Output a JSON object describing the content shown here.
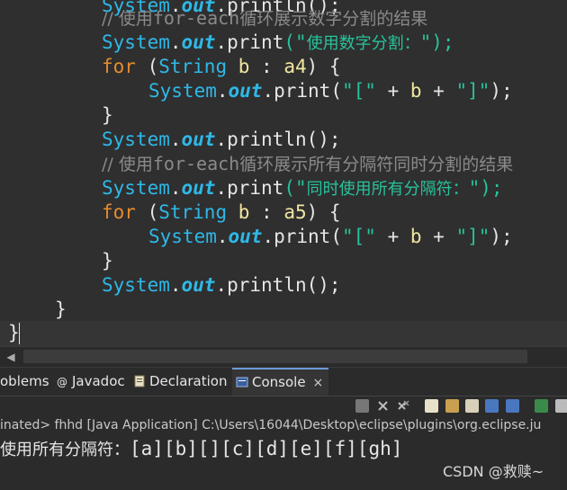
{
  "editor": {
    "line0": {
      "a": "System",
      "b": "out",
      "c": "println",
      "d": "();"
    },
    "line1": {
      "slash": "// ",
      "cn1": "使用",
      "kw": "for-each",
      "cn2": "循环展示数字分割的结果"
    },
    "line2": {
      "a": "System",
      "dot1": ".",
      "b": "out",
      "dot2": ".",
      "c": "print",
      "p1": "(\"",
      "s": "使用数字分割：",
      "p2": "\");"
    },
    "line3": {
      "a": "for",
      "b": " (",
      "c": "String",
      "d": " ",
      "e": "b",
      "f": " : ",
      "g": "a4",
      "h": ") {"
    },
    "line4": {
      "a": "System",
      "dot1": ".",
      "b": "out",
      "dot2": ".",
      "c": "print",
      "p1": "(",
      "s1": "\"[\"",
      "op1": " + ",
      "v": "b",
      "op2": " + ",
      "s2": "\"]\"",
      "p2": ");"
    },
    "line5": {
      "a": "}"
    },
    "line6": {
      "a": "System",
      "dot1": ".",
      "b": "out",
      "dot2": ".",
      "c": "println",
      "d": "();"
    },
    "line7": {
      "slash": "// ",
      "cn1": "使用",
      "kw": "for-each",
      "cn2": "循环展示所有分隔符同时分割的结果"
    },
    "line8": {
      "a": "System",
      "dot1": ".",
      "b": "out",
      "dot2": ".",
      "c": "print",
      "p1": "(\"",
      "s": "同时使用所有分隔符：",
      "p2": "\");"
    },
    "line9": {
      "a": "for",
      "b": " (",
      "c": "String",
      "d": " ",
      "e": "b",
      "f": " : ",
      "g": "a5",
      "h": ") {"
    },
    "line10": {
      "a": "System",
      "dot1": ".",
      "b": "out",
      "dot2": ".",
      "c": "print",
      "p1": "(",
      "s1": "\"[\"",
      "op1": " + ",
      "v": "b",
      "op2": " + ",
      "s2": "\"]\"",
      "p2": ");"
    },
    "line11": {
      "a": "}"
    },
    "line12": {
      "a": "System",
      "dot1": ".",
      "b": "out",
      "dot2": ".",
      "c": "println",
      "d": "();"
    },
    "line13": {
      "a": "}"
    },
    "line14": {
      "a": "}"
    }
  },
  "tabs": [
    {
      "label": "oblems",
      "icon": "problems-icon"
    },
    {
      "label": "Javadoc",
      "icon": "javadoc-icon"
    },
    {
      "label": "Declaration",
      "icon": "declaration-icon"
    },
    {
      "label": "Console",
      "icon": "console-icon",
      "active": true,
      "close": "×"
    }
  ],
  "status": "inated> fhhd [Java Application] C:\\Users\\16044\\Desktop\\eclipse\\plugins\\org.eclipse.ju",
  "console_output": {
    "cn": "使用所有分隔符：",
    "rest": "[a][b][][c][d][e][f][gh]"
  },
  "watermark": "CSDN @救赎~",
  "colors": {
    "background": "#2f2f2f",
    "type": "#2fb8e8",
    "keyword": "#e58b2d",
    "string": "#27c39c",
    "comment": "#8a8a8a"
  }
}
